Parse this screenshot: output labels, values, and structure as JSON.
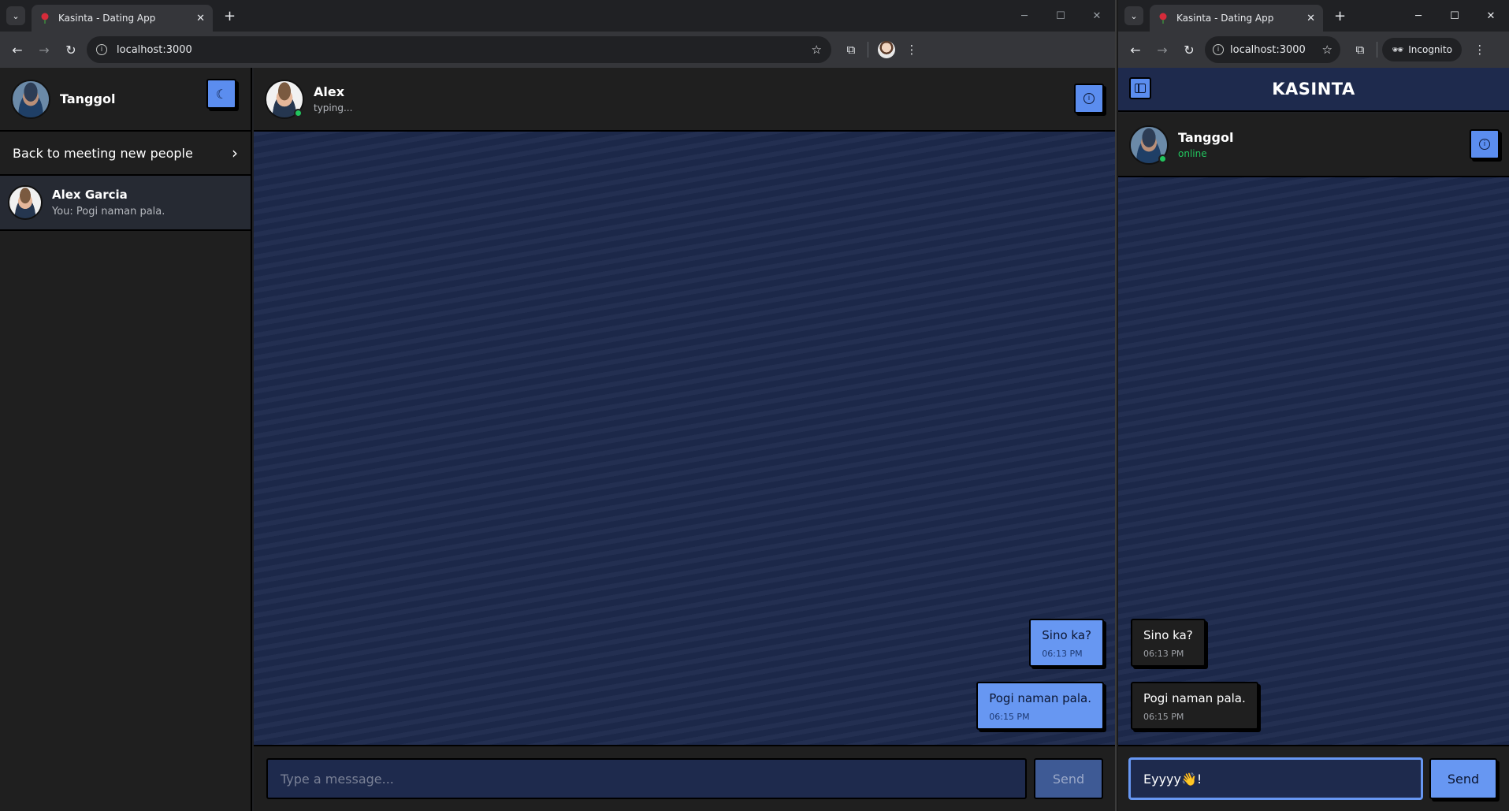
{
  "left_window": {
    "tab_title": "Kasinta - Dating App",
    "url": "localhost:3000",
    "sidebar": {
      "user_name": "Tanggol",
      "back_label": "Back to meeting new people",
      "conversations": [
        {
          "name": "Alex Garcia",
          "preview": "You: Pogi naman pala."
        }
      ]
    },
    "chat": {
      "contact_name": "Alex",
      "contact_status": "typing...",
      "messages": [
        {
          "text": "Sino ka?",
          "time": "06:13 PM"
        },
        {
          "text": "Pogi naman pala.",
          "time": "06:15 PM"
        }
      ],
      "input_placeholder": "Type a message...",
      "send_label": "Send"
    }
  },
  "right_window": {
    "tab_title": "Kasinta - Dating App",
    "url": "localhost:3000",
    "incognito_label": "Incognito",
    "app_title": "KASINTA",
    "chat": {
      "contact_name": "Tanggol",
      "contact_status": "online",
      "messages": [
        {
          "text": "Sino ka?",
          "time": "06:13 PM"
        },
        {
          "text": "Pogi naman pala.",
          "time": "06:15 PM"
        }
      ],
      "input_value": "Eyyyy👋!",
      "send_label": "Send"
    }
  },
  "colors": {
    "accent": "#6797f2",
    "online": "#22c55e",
    "chat_bg": "#1e2a4d",
    "panel_bg": "#1f1f1f"
  }
}
